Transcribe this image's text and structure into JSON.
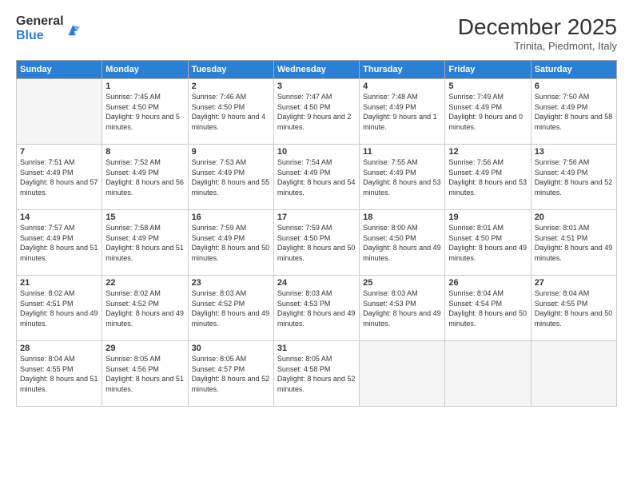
{
  "logo": {
    "general": "General",
    "blue": "Blue"
  },
  "header": {
    "month": "December 2025",
    "location": "Trinita, Piedmont, Italy"
  },
  "weekdays": [
    "Sunday",
    "Monday",
    "Tuesday",
    "Wednesday",
    "Thursday",
    "Friday",
    "Saturday"
  ],
  "weeks": [
    [
      {
        "day": null,
        "info": null
      },
      {
        "day": "1",
        "info": "Sunrise: 7:45 AM\nSunset: 4:50 PM\nDaylight: 9 hours\nand 5 minutes."
      },
      {
        "day": "2",
        "info": "Sunrise: 7:46 AM\nSunset: 4:50 PM\nDaylight: 9 hours\nand 4 minutes."
      },
      {
        "day": "3",
        "info": "Sunrise: 7:47 AM\nSunset: 4:50 PM\nDaylight: 9 hours\nand 2 minutes."
      },
      {
        "day": "4",
        "info": "Sunrise: 7:48 AM\nSunset: 4:49 PM\nDaylight: 9 hours\nand 1 minute."
      },
      {
        "day": "5",
        "info": "Sunrise: 7:49 AM\nSunset: 4:49 PM\nDaylight: 9 hours\nand 0 minutes."
      },
      {
        "day": "6",
        "info": "Sunrise: 7:50 AM\nSunset: 4:49 PM\nDaylight: 8 hours\nand 58 minutes."
      }
    ],
    [
      {
        "day": "7",
        "info": "Sunrise: 7:51 AM\nSunset: 4:49 PM\nDaylight: 8 hours\nand 57 minutes."
      },
      {
        "day": "8",
        "info": "Sunrise: 7:52 AM\nSunset: 4:49 PM\nDaylight: 8 hours\nand 56 minutes."
      },
      {
        "day": "9",
        "info": "Sunrise: 7:53 AM\nSunset: 4:49 PM\nDaylight: 8 hours\nand 55 minutes."
      },
      {
        "day": "10",
        "info": "Sunrise: 7:54 AM\nSunset: 4:49 PM\nDaylight: 8 hours\nand 54 minutes."
      },
      {
        "day": "11",
        "info": "Sunrise: 7:55 AM\nSunset: 4:49 PM\nDaylight: 8 hours\nand 53 minutes."
      },
      {
        "day": "12",
        "info": "Sunrise: 7:56 AM\nSunset: 4:49 PM\nDaylight: 8 hours\nand 53 minutes."
      },
      {
        "day": "13",
        "info": "Sunrise: 7:56 AM\nSunset: 4:49 PM\nDaylight: 8 hours\nand 52 minutes."
      }
    ],
    [
      {
        "day": "14",
        "info": "Sunrise: 7:57 AM\nSunset: 4:49 PM\nDaylight: 8 hours\nand 51 minutes."
      },
      {
        "day": "15",
        "info": "Sunrise: 7:58 AM\nSunset: 4:49 PM\nDaylight: 8 hours\nand 51 minutes."
      },
      {
        "day": "16",
        "info": "Sunrise: 7:59 AM\nSunset: 4:49 PM\nDaylight: 8 hours\nand 50 minutes."
      },
      {
        "day": "17",
        "info": "Sunrise: 7:59 AM\nSunset: 4:50 PM\nDaylight: 8 hours\nand 50 minutes."
      },
      {
        "day": "18",
        "info": "Sunrise: 8:00 AM\nSunset: 4:50 PM\nDaylight: 8 hours\nand 49 minutes."
      },
      {
        "day": "19",
        "info": "Sunrise: 8:01 AM\nSunset: 4:50 PM\nDaylight: 8 hours\nand 49 minutes."
      },
      {
        "day": "20",
        "info": "Sunrise: 8:01 AM\nSunset: 4:51 PM\nDaylight: 8 hours\nand 49 minutes."
      }
    ],
    [
      {
        "day": "21",
        "info": "Sunrise: 8:02 AM\nSunset: 4:51 PM\nDaylight: 8 hours\nand 49 minutes."
      },
      {
        "day": "22",
        "info": "Sunrise: 8:02 AM\nSunset: 4:52 PM\nDaylight: 8 hours\nand 49 minutes."
      },
      {
        "day": "23",
        "info": "Sunrise: 8:03 AM\nSunset: 4:52 PM\nDaylight: 8 hours\nand 49 minutes."
      },
      {
        "day": "24",
        "info": "Sunrise: 8:03 AM\nSunset: 4:53 PM\nDaylight: 8 hours\nand 49 minutes."
      },
      {
        "day": "25",
        "info": "Sunrise: 8:03 AM\nSunset: 4:53 PM\nDaylight: 8 hours\nand 49 minutes."
      },
      {
        "day": "26",
        "info": "Sunrise: 8:04 AM\nSunset: 4:54 PM\nDaylight: 8 hours\nand 50 minutes."
      },
      {
        "day": "27",
        "info": "Sunrise: 8:04 AM\nSunset: 4:55 PM\nDaylight: 8 hours\nand 50 minutes."
      }
    ],
    [
      {
        "day": "28",
        "info": "Sunrise: 8:04 AM\nSunset: 4:55 PM\nDaylight: 8 hours\nand 51 minutes."
      },
      {
        "day": "29",
        "info": "Sunrise: 8:05 AM\nSunset: 4:56 PM\nDaylight: 8 hours\nand 51 minutes."
      },
      {
        "day": "30",
        "info": "Sunrise: 8:05 AM\nSunset: 4:57 PM\nDaylight: 8 hours\nand 52 minutes."
      },
      {
        "day": "31",
        "info": "Sunrise: 8:05 AM\nSunset: 4:58 PM\nDaylight: 8 hours\nand 52 minutes."
      },
      {
        "day": null,
        "info": null
      },
      {
        "day": null,
        "info": null
      },
      {
        "day": null,
        "info": null
      }
    ]
  ]
}
